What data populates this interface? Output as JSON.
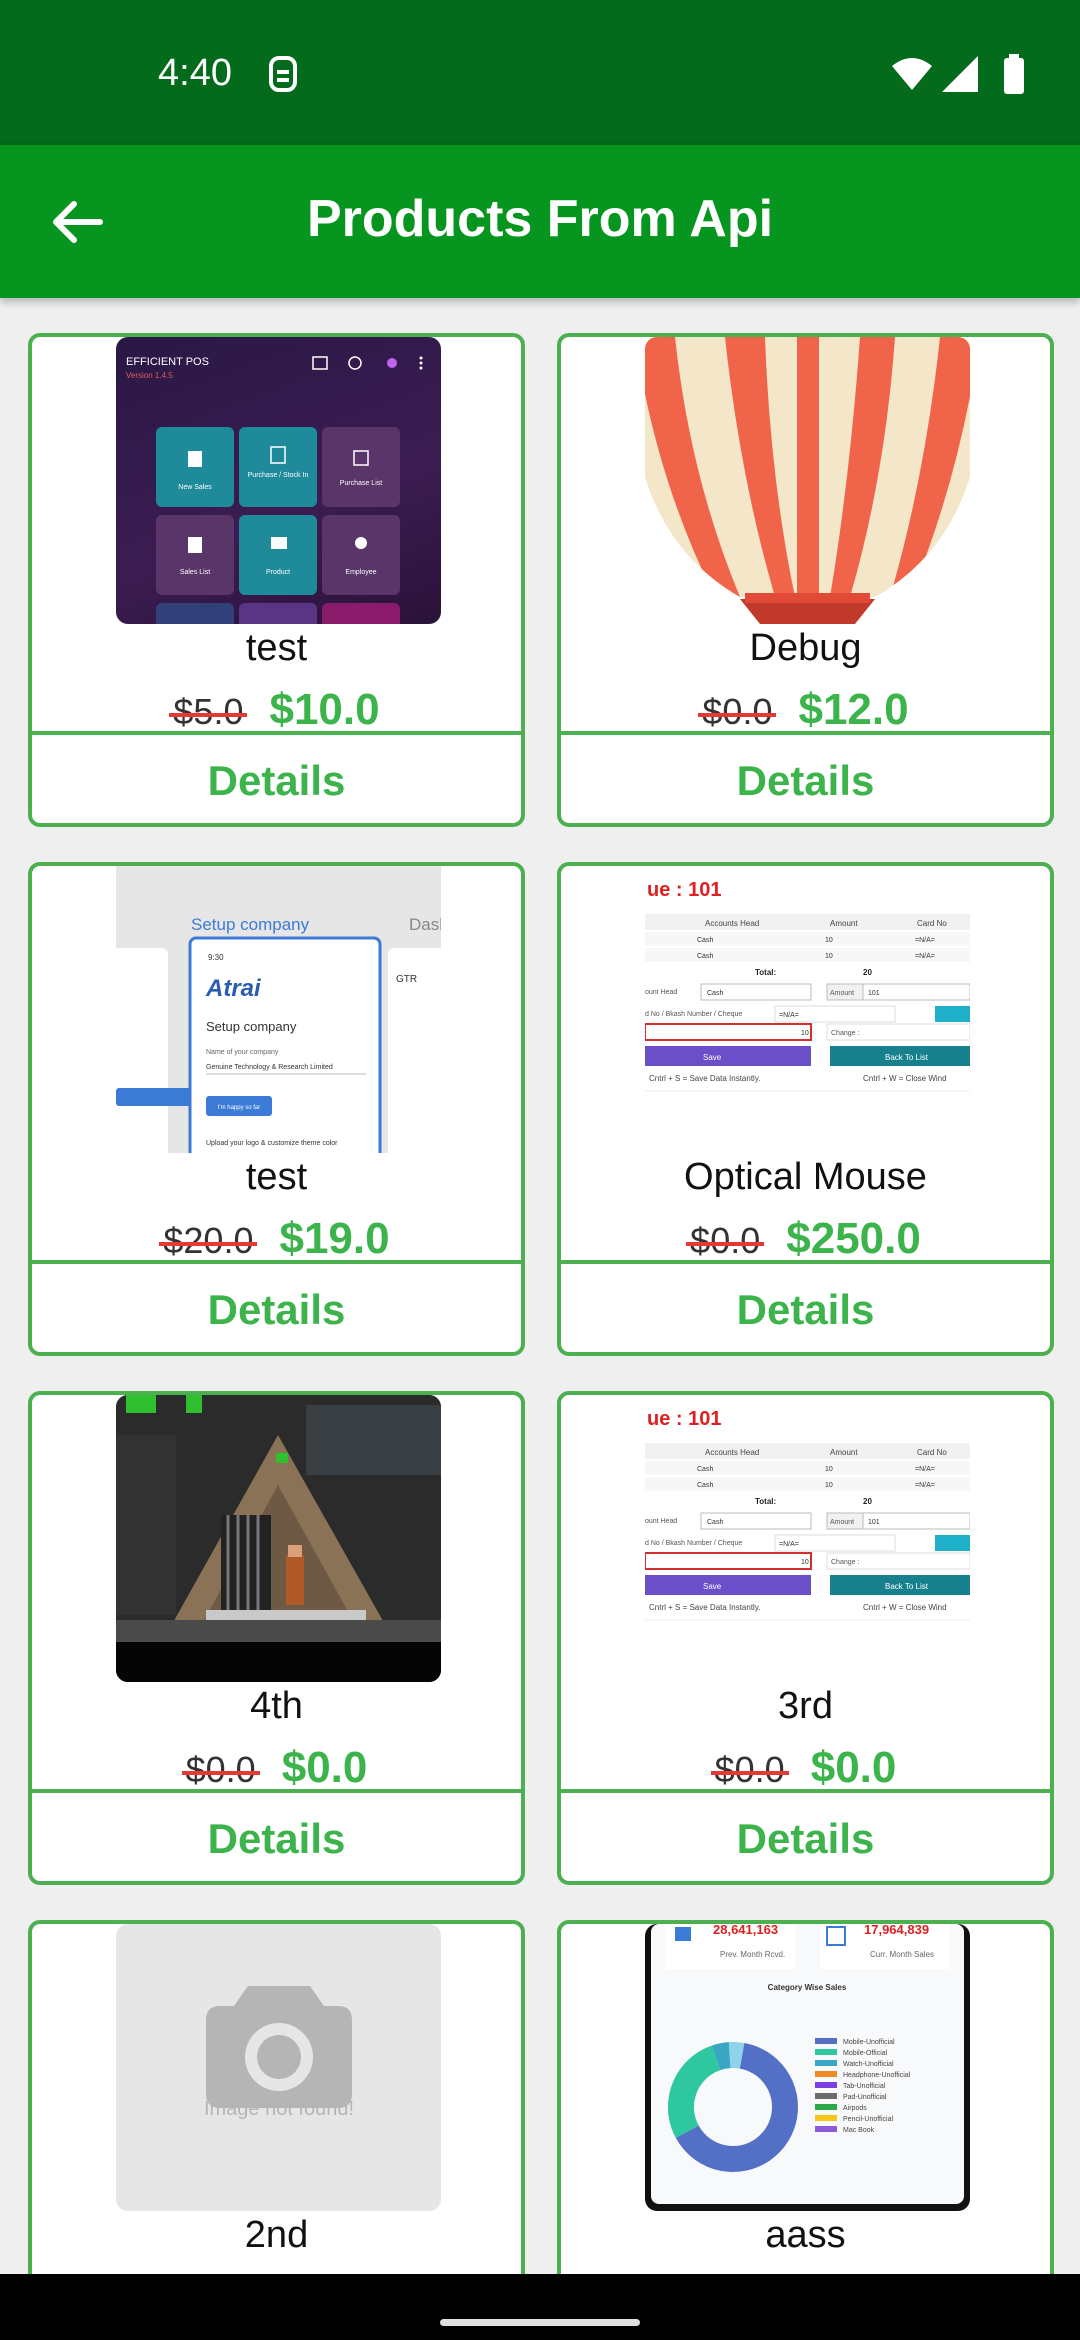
{
  "status_bar": {
    "time": "4:40"
  },
  "app_bar": {
    "title": "Products From Api"
  },
  "products": [
    {
      "name": "test",
      "old_price": "$5.0",
      "new_price": "$10.0",
      "details_label": "Details",
      "image": "pos-app-screenshot"
    },
    {
      "name": "Debug",
      "old_price": "$0.0",
      "new_price": "$12.0",
      "details_label": "Details",
      "image": "hot-air-balloon"
    },
    {
      "name": "test",
      "old_price": "$20.0",
      "new_price": "$19.0",
      "details_label": "Details",
      "image": "setup-company-screenshot"
    },
    {
      "name": "Optical Mouse",
      "old_price": "$0.0",
      "new_price": "$250.0",
      "details_label": "Details",
      "image": "payment-form-screenshot"
    },
    {
      "name": "4th",
      "old_price": "$0.0",
      "new_price": "$0.0",
      "details_label": "Details",
      "image": "pixel-game-scene"
    },
    {
      "name": "3rd",
      "old_price": "$0.0",
      "new_price": "$0.0",
      "details_label": "Details",
      "image": "payment-form-screenshot"
    },
    {
      "name": "2nd",
      "image": "placeholder-camera"
    },
    {
      "name": "aass",
      "image": "sales-donut-chart"
    }
  ],
  "images": {
    "pos": {
      "app_name": "EFFICIENT POS",
      "version": "Version 1.4.5",
      "tiles": [
        "New Sales",
        "Purchase / Stock In",
        "Purchase List",
        "Sales List",
        "Product",
        "Employee"
      ]
    },
    "setup": {
      "header": "Setup company",
      "side_label": "Dash",
      "clock": "9:30",
      "brand": "Atrai",
      "heading": "Setup company",
      "field_label": "Name of your company",
      "field_value": "Genuine Technology & Research Limited",
      "button": "I'm happy so far",
      "footer": "Upload your logo & customize theme color",
      "right_label": "GTR"
    },
    "payment": {
      "title": "ue : 101",
      "col1": "Accounts Head",
      "col2": "Amount",
      "col3": "Card No",
      "row_head": "Cash",
      "row_amount": "10",
      "row_card": "=N/A=",
      "total_label": "Total:",
      "total_value": "20",
      "account_head": "ount Head",
      "amount_label": "Amount",
      "amount_value": "101",
      "cheque_label": "d No / Bkash Number / Cheque",
      "cheque_value": "=N/A=",
      "change_label": "Change :",
      "save": "Save",
      "back": "Back To List",
      "hint1": "Cntrl + S = Save Data Instantly.",
      "hint2": "Cntrl + W = Close Wind"
    },
    "placeholder_text": "Image not found!",
    "sales": {
      "prev_value": "28,641,163",
      "prev_label": "Prev. Month Rcvd.",
      "curr_value": "17,964,839",
      "curr_label": "Curr. Month Sales",
      "title": "Category Wise Sales",
      "legend": [
        "Mobile-Unofficial",
        "Mobile-Official",
        "Watch-Unofficial",
        "Headphone-Unofficial",
        "Tab-Unofficial",
        "Pad-Unofficial",
        "Airpods",
        "Pencil-Unofficial",
        "Mac Book"
      ],
      "legend_colors": [
        "#5470c6",
        "#2ec7a0",
        "#3ba6c4",
        "#f08a24",
        "#7b3fe4",
        "#6b6b6b",
        "#2aa84a",
        "#f5c518",
        "#8e5bd6"
      ]
    }
  }
}
